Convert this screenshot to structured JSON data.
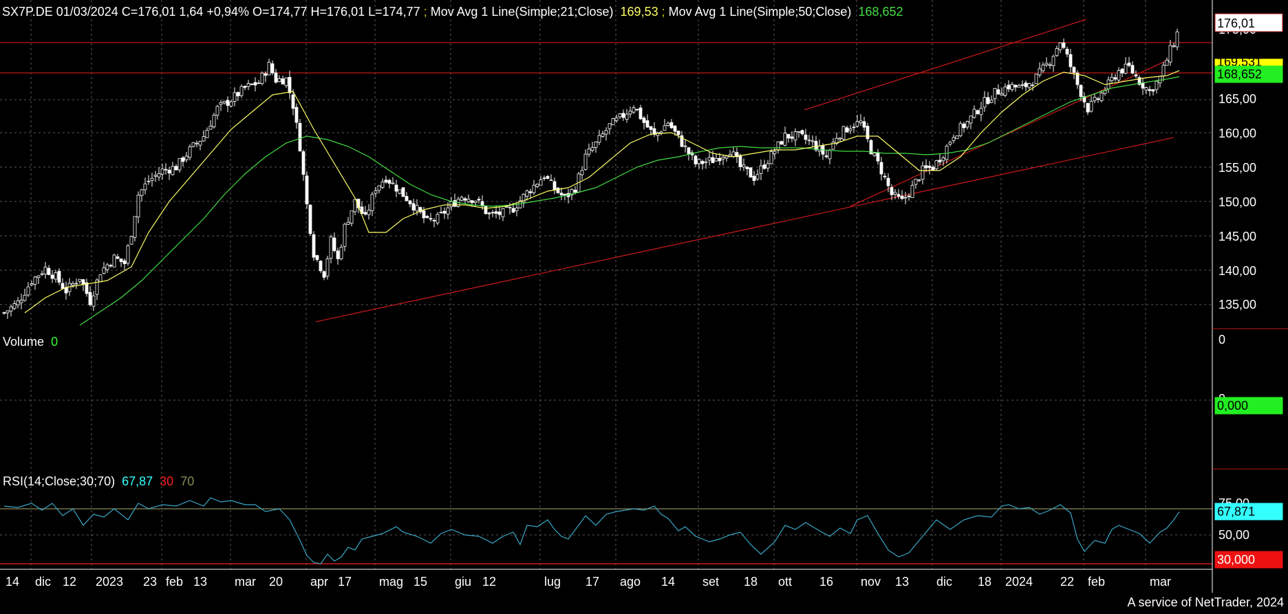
{
  "colors": {
    "background": "#000000",
    "grid": "#5a5a5a",
    "candle": "#ffffff",
    "ma21": "#ffff66",
    "ma50": "#44dd44",
    "trendline": "#c01818",
    "rsi_line": "#3aa8c8",
    "rsi_value": "#33ffff",
    "rsi_lower": "#ff2020",
    "rsi_upper": "#8a8a5a",
    "volume_value": "#33ff33",
    "axis_text": "#ffffff"
  },
  "header": {
    "quote_text": "SX7P.DE 01/03/2024 C=176,01 1,64 +0,94% O=174,77 H=176,01 L=174,77",
    "ma21_label": "Mov Avg 1 Line(Simple;21;Close)",
    "ma21_value": "169,53",
    "ma50_label": "Mov Avg 1 Line(Simple;50;Close)",
    "ma50_value": "168,652"
  },
  "price_axis": {
    "ticks": [
      "175,00",
      "165,00",
      "160,00",
      "155,00",
      "150,00",
      "145,00",
      "140,00",
      "135,00"
    ],
    "last_price_tag": "176,01",
    "ma21_tag": "169,531",
    "ma50_tag": "168,652"
  },
  "volume_panel": {
    "label": "Volume",
    "value": "0",
    "axis_top": "0",
    "axis_mid": "0",
    "tag": "0,000"
  },
  "rsi_panel": {
    "label": "RSI(14;Close;30;70)",
    "value": "67,87",
    "lower": "30",
    "upper": "70",
    "axis_top": "75,00",
    "axis_mid": "50,00",
    "tag_value": "67,871",
    "tag_lower": "30,000"
  },
  "date_axis": [
    {
      "label": "14",
      "x": 0.0
    },
    {
      "label": "dic",
      "x": 4.3
    },
    {
      "label": "12",
      "x": 8.3
    },
    {
      "label": "2023",
      "x": 13.1
    },
    {
      "label": "23",
      "x": 20.0
    },
    {
      "label": "feb",
      "x": 23.3
    },
    {
      "label": "13",
      "x": 27.3
    },
    {
      "label": "mar",
      "x": 33.3
    },
    {
      "label": "20",
      "x": 38.3
    },
    {
      "label": "apr",
      "x": 44.3
    },
    {
      "label": "17",
      "x": 48.3
    },
    {
      "label": "mag",
      "x": 54.3
    },
    {
      "label": "15",
      "x": 59.3
    },
    {
      "label": "giu",
      "x": 65.3
    },
    {
      "label": "12",
      "x": 69.3
    },
    {
      "label": "lug",
      "x": 78.3
    },
    {
      "label": "17",
      "x": 84.3
    },
    {
      "label": "ago",
      "x": 89.3
    },
    {
      "label": "14",
      "x": 95.3
    },
    {
      "label": "set",
      "x": 101.3
    },
    {
      "label": "18",
      "x": 107.3
    },
    {
      "label": "ott",
      "x": 112.3
    },
    {
      "label": "16",
      "x": 118.3
    },
    {
      "label": "nov",
      "x": 124.3
    },
    {
      "label": "13",
      "x": 129.3
    },
    {
      "label": "dic",
      "x": 135.3
    },
    {
      "label": "18",
      "x": 141.3
    },
    {
      "label": "2024",
      "x": 145.3
    },
    {
      "label": "22",
      "x": 153.3
    },
    {
      "label": "feb",
      "x": 157.3
    },
    {
      "label": "mar",
      "x": 166.3
    }
  ],
  "footer": {
    "credit": "A service of NetTrader, 2024"
  },
  "chart_data": {
    "type": "candlestick",
    "title": "SX7P.DE",
    "price_range": [
      132.0,
      176.6
    ],
    "rsi_range": [
      26.0,
      82.0
    ],
    "x_range": [
      0,
      170
    ],
    "horizontal_levels": [
      173.6,
      169.2
    ],
    "trendlines": [
      {
        "x1": 45.3,
        "y1": 133.0,
        "x2": 170.0,
        "y2": 159.8
      },
      {
        "x1": 123.0,
        "y1": 149.8,
        "x2": 169.0,
        "y2": 171.0
      },
      {
        "x1": 116.3,
        "y1": 163.8,
        "x2": 157.3,
        "y2": 177.0
      }
    ],
    "close_path": [
      [
        0.0,
        134.3
      ],
      [
        2.0,
        135.8
      ],
      [
        4.0,
        139.0
      ],
      [
        6.0,
        140.8
      ],
      [
        7.5,
        139.5
      ],
      [
        9.0,
        137.5
      ],
      [
        11.0,
        139.5
      ],
      [
        12.5,
        136.0
      ],
      [
        14.0,
        140.3
      ],
      [
        16.0,
        142.3
      ],
      [
        17.5,
        141.5
      ],
      [
        18.5,
        146.0
      ],
      [
        19.5,
        151.5
      ],
      [
        21.0,
        153.5
      ],
      [
        23.0,
        155.0
      ],
      [
        25.0,
        155.5
      ],
      [
        27.0,
        158.0
      ],
      [
        29.0,
        160.0
      ],
      [
        31.0,
        164.0
      ],
      [
        33.0,
        165.3
      ],
      [
        35.0,
        167.0
      ],
      [
        37.0,
        167.8
      ],
      [
        38.5,
        170.3
      ],
      [
        39.5,
        168.2
      ],
      [
        41.0,
        168.3
      ],
      [
        42.0,
        164.5
      ],
      [
        43.0,
        158.5
      ],
      [
        44.0,
        150.0
      ],
      [
        45.0,
        143.0
      ],
      [
        46.5,
        140.0
      ],
      [
        47.5,
        144.8
      ],
      [
        48.5,
        142.0
      ],
      [
        49.5,
        146.8
      ],
      [
        51.0,
        150.5
      ],
      [
        52.5,
        148.0
      ],
      [
        54.0,
        152.5
      ],
      [
        55.5,
        154.0
      ],
      [
        57.5,
        152.0
      ],
      [
        59.0,
        150.5
      ],
      [
        61.5,
        147.5
      ],
      [
        63.0,
        148.0
      ],
      [
        65.0,
        150.0
      ],
      [
        66.5,
        151.3
      ],
      [
        68.5,
        150.8
      ],
      [
        70.5,
        148.5
      ],
      [
        72.5,
        148.8
      ],
      [
        74.0,
        149.5
      ],
      [
        76.0,
        151.8
      ],
      [
        78.5,
        154.3
      ],
      [
        80.0,
        152.3
      ],
      [
        81.5,
        151.0
      ],
      [
        83.0,
        152.5
      ],
      [
        84.5,
        157.0
      ],
      [
        86.5,
        159.5
      ],
      [
        88.0,
        161.5
      ],
      [
        90.0,
        163.0
      ],
      [
        91.5,
        164.5
      ],
      [
        93.0,
        162.0
      ],
      [
        94.5,
        160.0
      ],
      [
        96.5,
        162.0
      ],
      [
        98.5,
        159.0
      ],
      [
        100.5,
        156.0
      ],
      [
        103.0,
        156.5
      ],
      [
        105.5,
        158.0
      ],
      [
        107.0,
        155.5
      ],
      [
        109.0,
        154.0
      ],
      [
        111.0,
        156.5
      ],
      [
        113.5,
        160.0
      ],
      [
        115.5,
        160.0
      ],
      [
        117.5,
        159.0
      ],
      [
        119.5,
        157.0
      ],
      [
        121.0,
        160.0
      ],
      [
        123.0,
        161.5
      ],
      [
        124.5,
        162.0
      ],
      [
        126.0,
        158.0
      ],
      [
        127.5,
        155.0
      ],
      [
        129.0,
        151.5
      ],
      [
        130.5,
        150.5
      ],
      [
        132.0,
        152.5
      ],
      [
        133.5,
        155.0
      ],
      [
        135.0,
        155.5
      ],
      [
        136.5,
        157.5
      ],
      [
        138.0,
        160.3
      ],
      [
        140.0,
        162.0
      ],
      [
        142.0,
        164.5
      ],
      [
        144.0,
        166.3
      ],
      [
        146.0,
        167.3
      ],
      [
        148.0,
        167.0
      ],
      [
        150.0,
        168.5
      ],
      [
        152.0,
        171.0
      ],
      [
        153.5,
        173.8
      ],
      [
        154.5,
        171.5
      ],
      [
        156.0,
        167.5
      ],
      [
        157.5,
        164.0
      ],
      [
        159.0,
        165.5
      ],
      [
        160.5,
        167.5
      ],
      [
        162.0,
        169.5
      ],
      [
        163.5,
        170.0
      ],
      [
        165.0,
        168.0
      ],
      [
        166.5,
        166.5
      ],
      [
        168.0,
        168.5
      ],
      [
        169.5,
        172.5
      ],
      [
        170.3,
        174.3
      ],
      [
        170.8,
        176.0
      ]
    ],
    "ma21_path": [
      [
        3.0,
        134.3
      ],
      [
        6.0,
        136.5
      ],
      [
        9.0,
        138.0
      ],
      [
        12.0,
        138.5
      ],
      [
        15.0,
        139.0
      ],
      [
        18.5,
        141.0
      ],
      [
        21.0,
        146.0
      ],
      [
        24.0,
        150.5
      ],
      [
        27.0,
        154.0
      ],
      [
        30.0,
        157.5
      ],
      [
        33.0,
        161.0
      ],
      [
        36.0,
        163.5
      ],
      [
        39.0,
        166.0
      ],
      [
        42.0,
        166.5
      ],
      [
        45.0,
        161.0
      ],
      [
        48.0,
        156.0
      ],
      [
        51.0,
        151.0
      ],
      [
        53.0,
        146.0
      ],
      [
        55.5,
        146.0
      ],
      [
        58.0,
        148.0
      ],
      [
        61.0,
        149.3
      ],
      [
        64.0,
        150.0
      ],
      [
        67.0,
        150.0
      ],
      [
        70.0,
        149.5
      ],
      [
        73.0,
        149.8
      ],
      [
        76.0,
        150.8
      ],
      [
        79.0,
        152.0
      ],
      [
        82.0,
        152.5
      ],
      [
        85.0,
        154.0
      ],
      [
        88.0,
        156.5
      ],
      [
        91.0,
        159.0
      ],
      [
        94.0,
        160.3
      ],
      [
        97.0,
        160.5
      ],
      [
        100.0,
        159.0
      ],
      [
        103.0,
        157.5
      ],
      [
        106.0,
        157.0
      ],
      [
        109.0,
        157.5
      ],
      [
        112.0,
        158.0
      ],
      [
        115.0,
        158.0
      ],
      [
        118.0,
        158.5
      ],
      [
        121.0,
        159.0
      ],
      [
        124.0,
        160.0
      ],
      [
        127.0,
        160.0
      ],
      [
        130.0,
        157.5
      ],
      [
        133.0,
        155.0
      ],
      [
        136.0,
        155.0
      ],
      [
        139.0,
        157.0
      ],
      [
        142.0,
        160.5
      ],
      [
        145.0,
        163.5
      ],
      [
        148.0,
        166.0
      ],
      [
        151.0,
        168.0
      ],
      [
        154.0,
        169.3
      ],
      [
        157.0,
        168.8
      ],
      [
        160.0,
        167.5
      ],
      [
        163.0,
        168.0
      ],
      [
        166.0,
        168.5
      ],
      [
        169.0,
        168.8
      ],
      [
        170.8,
        169.53
      ]
    ],
    "ma50_path": [
      [
        11.0,
        132.5
      ],
      [
        14.0,
        134.5
      ],
      [
        17.0,
        136.5
      ],
      [
        20.0,
        139.0
      ],
      [
        23.0,
        142.0
      ],
      [
        26.0,
        145.0
      ],
      [
        29.0,
        148.0
      ],
      [
        32.0,
        151.5
      ],
      [
        35.0,
        154.5
      ],
      [
        38.0,
        157.0
      ],
      [
        41.0,
        159.0
      ],
      [
        44.0,
        160.0
      ],
      [
        47.0,
        159.5
      ],
      [
        50.0,
        158.5
      ],
      [
        53.0,
        157.0
      ],
      [
        56.0,
        155.0
      ],
      [
        59.0,
        153.0
      ],
      [
        62.0,
        151.5
      ],
      [
        65.0,
        150.5
      ],
      [
        68.0,
        150.0
      ],
      [
        71.0,
        149.8
      ],
      [
        74.0,
        150.0
      ],
      [
        77.0,
        150.5
      ],
      [
        80.0,
        151.0
      ],
      [
        83.0,
        151.7
      ],
      [
        86.0,
        152.5
      ],
      [
        89.0,
        154.0
      ],
      [
        92.0,
        155.5
      ],
      [
        95.0,
        156.5
      ],
      [
        98.0,
        157.0
      ],
      [
        101.0,
        157.7
      ],
      [
        104.0,
        158.3
      ],
      [
        107.0,
        158.5
      ],
      [
        110.0,
        158.3
      ],
      [
        113.0,
        158.3
      ],
      [
        116.0,
        158.3
      ],
      [
        119.0,
        158.0
      ],
      [
        122.0,
        157.8
      ],
      [
        125.0,
        157.8
      ],
      [
        128.0,
        157.5
      ],
      [
        131.0,
        157.5
      ],
      [
        134.0,
        157.3
      ],
      [
        137.0,
        157.5
      ],
      [
        140.0,
        158.0
      ],
      [
        143.0,
        159.0
      ],
      [
        146.0,
        160.5
      ],
      [
        149.0,
        162.0
      ],
      [
        152.0,
        163.5
      ],
      [
        155.0,
        165.0
      ],
      [
        158.0,
        166.0
      ],
      [
        161.0,
        167.0
      ],
      [
        164.0,
        167.5
      ],
      [
        167.0,
        168.0
      ],
      [
        169.0,
        168.3
      ],
      [
        170.8,
        168.652
      ]
    ],
    "rsi_path": [
      [
        0.0,
        72
      ],
      [
        2.0,
        71
      ],
      [
        4.0,
        74
      ],
      [
        5.5,
        69
      ],
      [
        7.0,
        74
      ],
      [
        8.5,
        65
      ],
      [
        10.0,
        70
      ],
      [
        11.5,
        58
      ],
      [
        13.0,
        66
      ],
      [
        14.5,
        64
      ],
      [
        16.0,
        70
      ],
      [
        18.0,
        62
      ],
      [
        19.5,
        74
      ],
      [
        21.0,
        70
      ],
      [
        23.0,
        73
      ],
      [
        25.0,
        72
      ],
      [
        27.0,
        76
      ],
      [
        29.0,
        72
      ],
      [
        30.0,
        78
      ],
      [
        31.5,
        75
      ],
      [
        33.0,
        76
      ],
      [
        35.0,
        73
      ],
      [
        36.5,
        73
      ],
      [
        38.0,
        68
      ],
      [
        40.0,
        70
      ],
      [
        41.5,
        62
      ],
      [
        43.0,
        47
      ],
      [
        44.0,
        36
      ],
      [
        45.0,
        31
      ],
      [
        46.0,
        30
      ],
      [
        47.0,
        37
      ],
      [
        48.0,
        32
      ],
      [
        49.0,
        35
      ],
      [
        50.0,
        42
      ],
      [
        51.0,
        40
      ],
      [
        52.0,
        48
      ],
      [
        53.5,
        50
      ],
      [
        55.0,
        52
      ],
      [
        57.0,
        57
      ],
      [
        58.0,
        53
      ],
      [
        60.0,
        50
      ],
      [
        62.0,
        45
      ],
      [
        63.5,
        52
      ],
      [
        65.0,
        55
      ],
      [
        67.0,
        51
      ],
      [
        69.0,
        50
      ],
      [
        71.0,
        45
      ],
      [
        72.5,
        50
      ],
      [
        74.0,
        53
      ],
      [
        75.0,
        44
      ],
      [
        76.0,
        58
      ],
      [
        77.5,
        57
      ],
      [
        79.0,
        62
      ],
      [
        80.0,
        55
      ],
      [
        81.0,
        50
      ],
      [
        82.0,
        48
      ],
      [
        83.5,
        58
      ],
      [
        84.5,
        65
      ],
      [
        86.0,
        58
      ],
      [
        87.5,
        66
      ],
      [
        89.0,
        68
      ],
      [
        91.5,
        70
      ],
      [
        93.0,
        69
      ],
      [
        94.5,
        72
      ],
      [
        95.5,
        66
      ],
      [
        96.5,
        63
      ],
      [
        98.0,
        54
      ],
      [
        99.0,
        57
      ],
      [
        100.5,
        50
      ],
      [
        102.5,
        46
      ],
      [
        104.0,
        48
      ],
      [
        105.5,
        51
      ],
      [
        107.0,
        53
      ],
      [
        108.5,
        44
      ],
      [
        110.0,
        37
      ],
      [
        112.0,
        46
      ],
      [
        113.5,
        58
      ],
      [
        115.0,
        55
      ],
      [
        116.5,
        60
      ],
      [
        118.5,
        54
      ],
      [
        120.0,
        50
      ],
      [
        121.5,
        56
      ],
      [
        123.0,
        52
      ],
      [
        124.0,
        62
      ],
      [
        125.5,
        65
      ],
      [
        127.0,
        52
      ],
      [
        128.5,
        40
      ],
      [
        130.0,
        35
      ],
      [
        131.5,
        38
      ],
      [
        133.5,
        50
      ],
      [
        135.5,
        62
      ],
      [
        137.5,
        55
      ],
      [
        139.5,
        62
      ],
      [
        141.5,
        65
      ],
      [
        143.5,
        64
      ],
      [
        145.0,
        72
      ],
      [
        146.0,
        73
      ],
      [
        147.5,
        70
      ],
      [
        149.0,
        71
      ],
      [
        150.5,
        66
      ],
      [
        152.0,
        69
      ],
      [
        153.5,
        73
      ],
      [
        155.0,
        67
      ],
      [
        156.0,
        48
      ],
      [
        157.0,
        39
      ],
      [
        158.5,
        47
      ],
      [
        160.0,
        45
      ],
      [
        161.0,
        55
      ],
      [
        162.0,
        58
      ],
      [
        163.5,
        55
      ],
      [
        165.0,
        52
      ],
      [
        166.5,
        45
      ],
      [
        168.0,
        53
      ],
      [
        169.0,
        56
      ],
      [
        170.0,
        62
      ],
      [
        170.8,
        67.87
      ]
    ]
  }
}
